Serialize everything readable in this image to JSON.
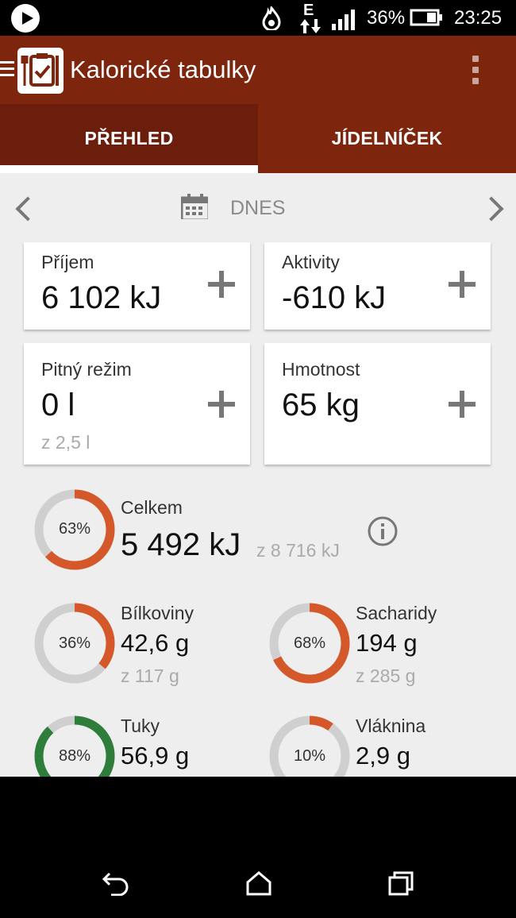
{
  "status_bar": {
    "network_type": "E",
    "battery_percent": "36%",
    "time": "23:25"
  },
  "app_bar": {
    "title": "Kalorické tabulky"
  },
  "tabs": [
    {
      "label": "PŘEHLED",
      "selected": true
    },
    {
      "label": "JÍDELNÍČEK",
      "selected": false
    }
  ],
  "date_nav": {
    "label": "DNES"
  },
  "cards": {
    "intake": {
      "label": "Příjem",
      "value": "6 102 kJ"
    },
    "activities": {
      "label": "Aktivity",
      "value": "-610 kJ"
    },
    "drinking": {
      "label": "Pitný režim",
      "value": "0 l",
      "of": "z 2,5 l"
    },
    "weight": {
      "label": "Hmotnost",
      "value": "65 kg"
    }
  },
  "total": {
    "label": "Celkem",
    "percent": "63%",
    "fraction": 0.63,
    "value": "5 492 kJ",
    "of": "z 8 716 kJ"
  },
  "nutrients": {
    "protein": {
      "label": "Bílkoviny",
      "percent": "36%",
      "fraction": 0.36,
      "value": "42,6 g",
      "of": "z 117 g"
    },
    "carbs": {
      "label": "Sacharidy",
      "percent": "68%",
      "fraction": 0.68,
      "value": "194 g",
      "of": "z 285 g"
    },
    "fat": {
      "label": "Tuky",
      "percent": "88%",
      "fraction": 0.88,
      "value": "56,9 g"
    },
    "fiber": {
      "label": "Vláknina",
      "percent": "10%",
      "fraction": 0.1,
      "value": "2,9 g"
    }
  },
  "colors": {
    "brand_dark": "#7e250d",
    "ring_orange": "#d4582a",
    "ring_green": "#2e7d3a",
    "ring_track": "#cfcfcf"
  }
}
